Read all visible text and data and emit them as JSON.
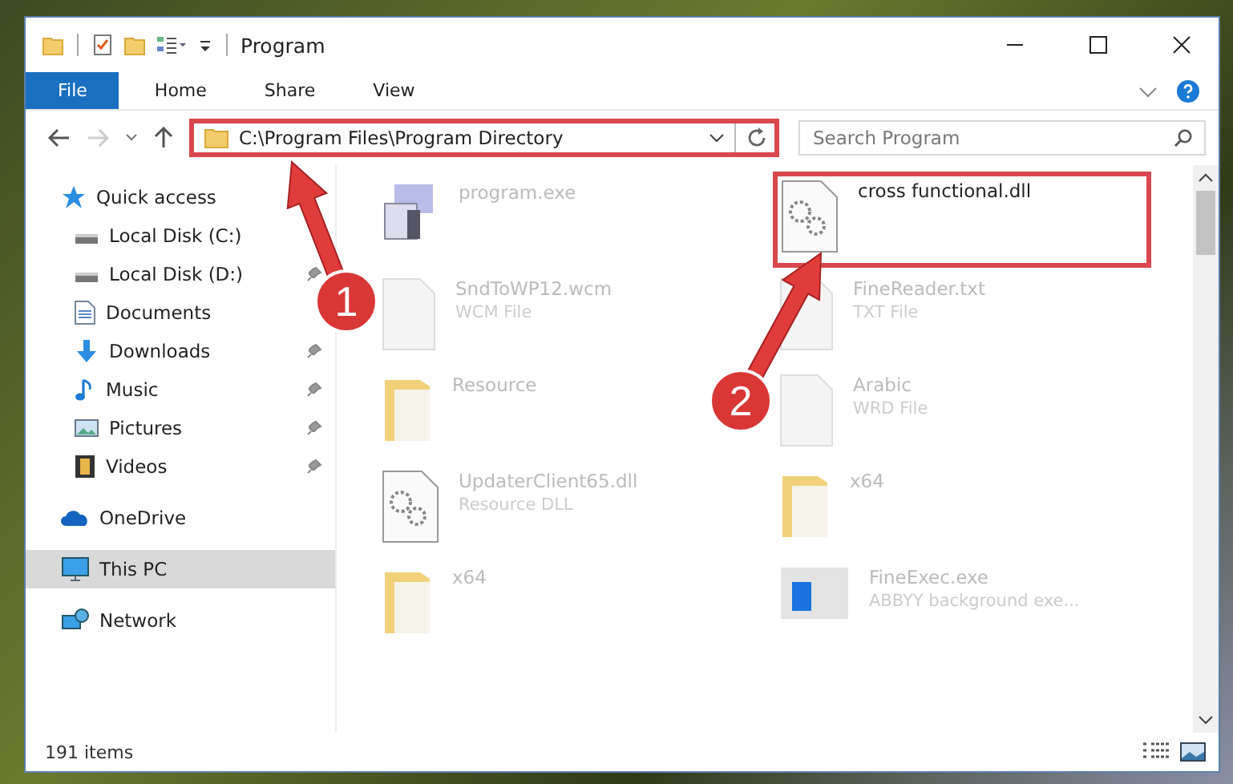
{
  "window": {
    "title": "Program"
  },
  "ribbon_tabs": [
    {
      "label": "File",
      "selected": true
    },
    {
      "label": "Home",
      "selected": false
    },
    {
      "label": "Share",
      "selected": false
    },
    {
      "label": "View",
      "selected": false
    }
  ],
  "address": {
    "path": "C:\\Program Files\\Program Directory",
    "highlighted": true
  },
  "search": {
    "placeholder": "Search Program"
  },
  "sidebar": {
    "items": [
      {
        "label": "Quick access",
        "kind": "star",
        "selected": false,
        "children": [
          {
            "label": "Local Disk (C:)",
            "kind": "disk",
            "pinned": false
          },
          {
            "label": "Local Disk (D:)",
            "kind": "disk",
            "pinned": true
          },
          {
            "label": "Documents",
            "kind": "docs",
            "pinned": false
          },
          {
            "label": "Downloads",
            "kind": "download",
            "pinned": true
          },
          {
            "label": "Music",
            "kind": "music",
            "pinned": true
          },
          {
            "label": "Pictures",
            "kind": "pictures",
            "pinned": true
          },
          {
            "label": "Videos",
            "kind": "videos",
            "pinned": true
          }
        ]
      },
      {
        "label": "OneDrive",
        "kind": "cloud",
        "selected": false
      },
      {
        "label": "This PC",
        "kind": "pc",
        "selected": true
      },
      {
        "label": "Network",
        "kind": "network",
        "selected": false
      }
    ]
  },
  "files": [
    {
      "name": "program.exe",
      "kind": "exe",
      "highlighted": false
    },
    {
      "name": "cross functional.dll",
      "kind": "dll",
      "highlighted": true
    },
    {
      "name": "SndToWP12.wcm",
      "type": "WCM File",
      "kind": "doc",
      "highlighted": false
    },
    {
      "name": "FineReader.txt",
      "type": "TXT File",
      "kind": "doc",
      "highlighted": false
    },
    {
      "name": "Resource",
      "kind": "folder",
      "highlighted": false
    },
    {
      "name": "Arabic",
      "type": "WRD File",
      "kind": "doc",
      "highlighted": false
    },
    {
      "name": "UpdaterClient65.dll",
      "type": "Resource DLL",
      "kind": "dll",
      "highlighted": false
    },
    {
      "name": "x64",
      "kind": "folder",
      "highlighted": false
    },
    {
      "name": "x64",
      "kind": "folder",
      "highlighted": false
    },
    {
      "name": "FineExec.exe",
      "type": "ABBYY background exe...",
      "kind": "app",
      "highlighted": false
    }
  ],
  "callouts": [
    {
      "number": "1"
    },
    {
      "number": "2"
    }
  ],
  "status_bar": {
    "count": "191 items"
  }
}
